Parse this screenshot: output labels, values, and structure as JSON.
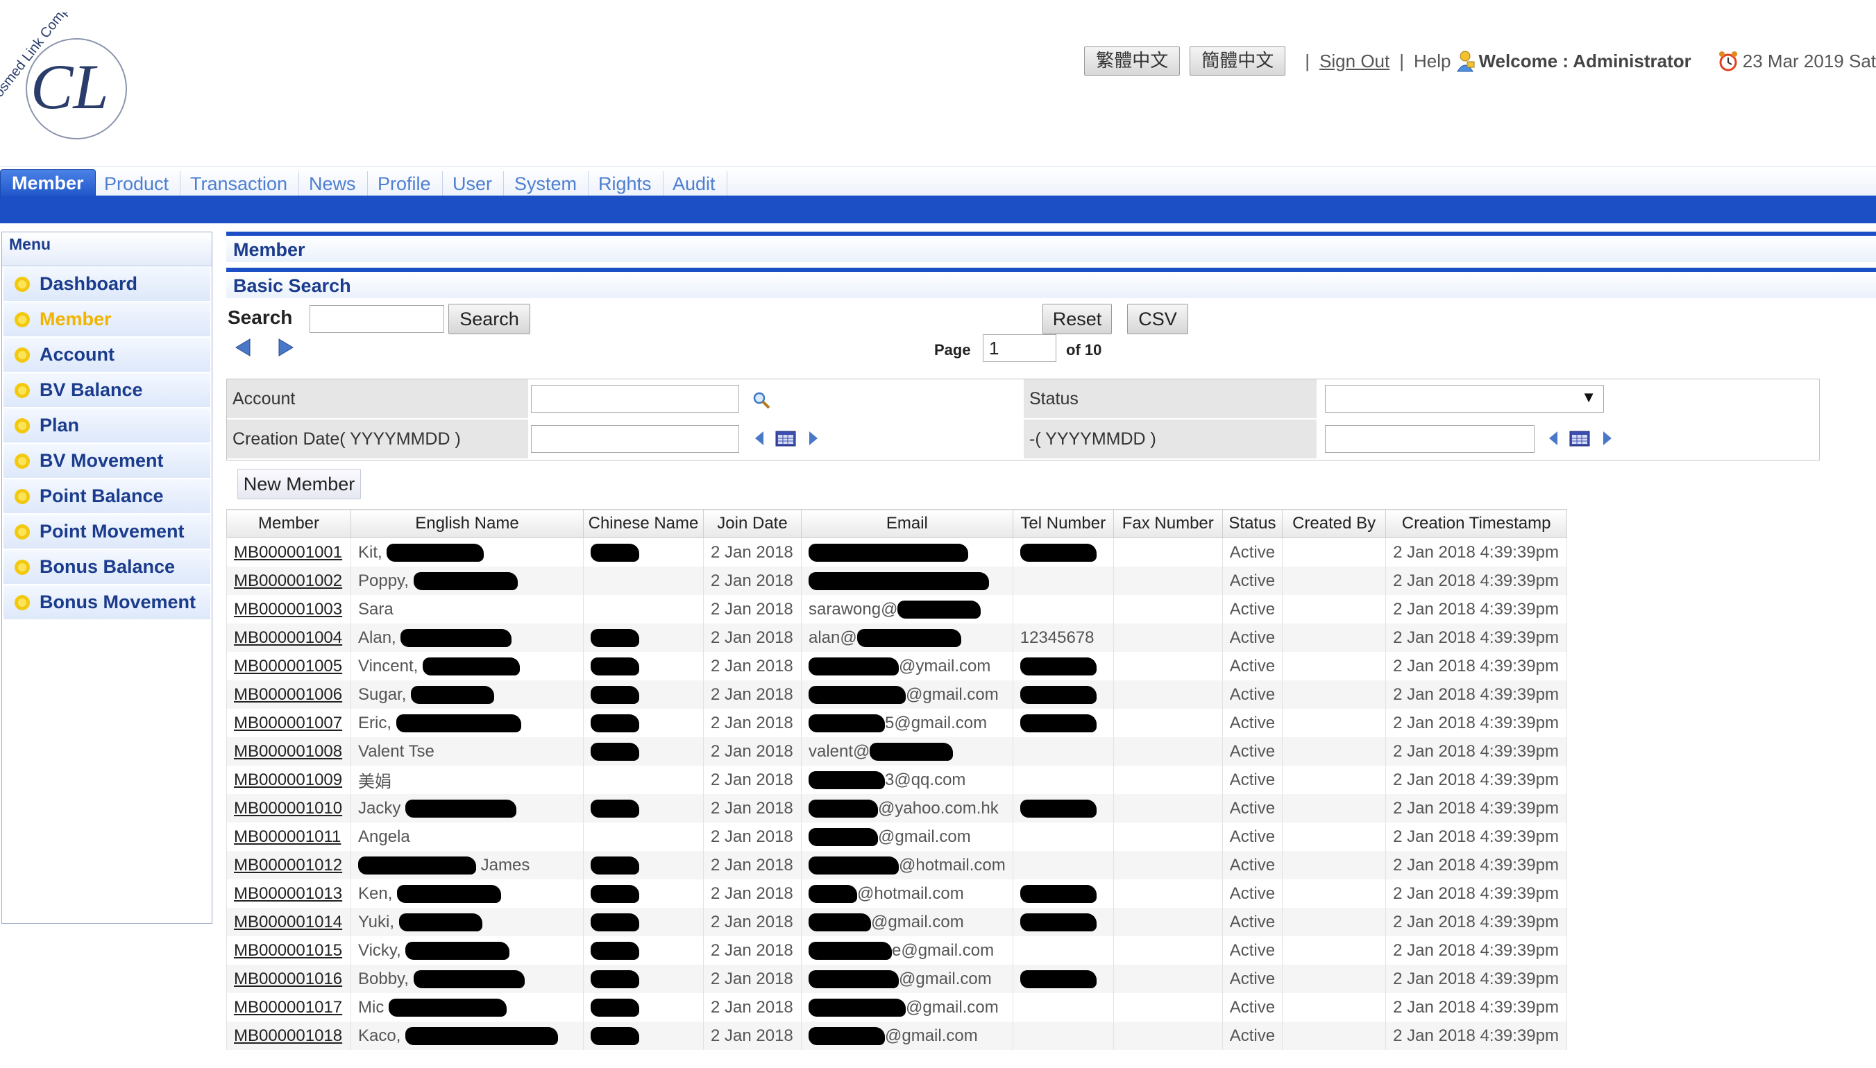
{
  "header": {
    "logo": {
      "initials": "CL",
      "ring_text": "Cosmed Link Company Ltd"
    },
    "lang_traditional": "繁體中文",
    "lang_simplified": "簡體中文",
    "separator": "|",
    "sign_out": "Sign Out",
    "help": "Help",
    "welcome": "Welcome : Administrator",
    "date": "23 Mar 2019 Sat"
  },
  "nav": {
    "tabs": [
      {
        "label": "Member",
        "active": true
      },
      {
        "label": "Product"
      },
      {
        "label": "Transaction"
      },
      {
        "label": "News"
      },
      {
        "label": "Profile"
      },
      {
        "label": "User"
      },
      {
        "label": "System"
      },
      {
        "label": "Rights"
      },
      {
        "label": "Audit"
      }
    ]
  },
  "sidebar": {
    "title": "Menu",
    "items": [
      {
        "label": "Dashboard"
      },
      {
        "label": "Member",
        "active": true
      },
      {
        "label": "Account"
      },
      {
        "label": "BV Balance"
      },
      {
        "label": "Plan"
      },
      {
        "label": "BV Movement"
      },
      {
        "label": "Point Balance"
      },
      {
        "label": "Point Movement"
      },
      {
        "label": "Bonus Balance"
      },
      {
        "label": "Bonus Movement"
      }
    ]
  },
  "main": {
    "title": "Member",
    "basic_search_title": "Basic Search",
    "search_label": "Search",
    "search_value": "",
    "search_button": "Search",
    "reset_button": "Reset",
    "csv_button": "CSV",
    "page_label": "Page",
    "page_value": "1",
    "page_of": "of 10",
    "new_member_button": "New Member",
    "filter": {
      "account_label": "Account",
      "status_label": "Status",
      "creation_date_label": "Creation Date( YYYYMMDD )",
      "creation_date_to_label": "-( YYYYMMDD )"
    }
  },
  "table": {
    "columns": [
      "Member",
      "English Name",
      "Chinese Name",
      "Join Date",
      "Email",
      "Tel Number",
      "Fax Number",
      "Status",
      "Created By",
      "Creation Timestamp"
    ],
    "rows": [
      {
        "member": "MB000001001",
        "english": "Kit,",
        "email": "",
        "tel": "",
        "status": "Active",
        "created_by": "",
        "timestamp": "2 Jan 2018 4:39:39pm",
        "join": "2 Jan 2018"
      },
      {
        "member": "MB000001002",
        "english": "Poppy,",
        "email": "",
        "tel": "",
        "status": "Active",
        "created_by": "",
        "timestamp": "2 Jan 2018 4:39:39pm",
        "join": "2 Jan 2018"
      },
      {
        "member": "MB000001003",
        "english": "Sara",
        "email": "sarawong@",
        "tel": "",
        "status": "Active",
        "created_by": "",
        "timestamp": "2 Jan 2018 4:39:39pm",
        "join": "2 Jan 2018"
      },
      {
        "member": "MB000001004",
        "english": "Alan,",
        "email": "alan@",
        "tel": "12345678",
        "status": "Active",
        "created_by": "",
        "timestamp": "2 Jan 2018 4:39:39pm",
        "join": "2 Jan 2018"
      },
      {
        "member": "MB000001005",
        "english": "Vincent,",
        "email": "@ymail.com",
        "tel": "",
        "status": "Active",
        "created_by": "",
        "timestamp": "2 Jan 2018 4:39:39pm",
        "join": "2 Jan 2018"
      },
      {
        "member": "MB000001006",
        "english": "Sugar,",
        "email": "@gmail.com",
        "tel": "",
        "status": "Active",
        "created_by": "",
        "timestamp": "2 Jan 2018 4:39:39pm",
        "join": "2 Jan 2018"
      },
      {
        "member": "MB000001007",
        "english": "Eric,",
        "email": "5@gmail.com",
        "tel": "",
        "status": "Active",
        "created_by": "",
        "timestamp": "2 Jan 2018 4:39:39pm",
        "join": "2 Jan 2018"
      },
      {
        "member": "MB000001008",
        "english": "Valent Tse",
        "email": "valent@",
        "tel": "",
        "status": "Active",
        "created_by": "",
        "timestamp": "2 Jan 2018 4:39:39pm",
        "join": "2 Jan 2018"
      },
      {
        "member": "MB000001009",
        "english": "美娟",
        "email": "3@qq.com",
        "tel": "",
        "status": "Active",
        "created_by": "",
        "timestamp": "2 Jan 2018 4:39:39pm",
        "join": "2 Jan 2018"
      },
      {
        "member": "MB000001010",
        "english": "Jacky",
        "email": "@yahoo.com.hk",
        "tel": "",
        "status": "Active",
        "created_by": "",
        "timestamp": "2 Jan 2018 4:39:39pm",
        "join": "2 Jan 2018"
      },
      {
        "member": "MB000001011",
        "english": "Angela",
        "email": "@gmail.com",
        "tel": "",
        "status": "Active",
        "created_by": "",
        "timestamp": "2 Jan 2018 4:39:39pm",
        "join": "2 Jan 2018"
      },
      {
        "member": "MB000001012",
        "english": "James",
        "email": "@hotmail.com",
        "tel": "",
        "status": "Active",
        "created_by": "",
        "timestamp": "2 Jan 2018 4:39:39pm",
        "join": "2 Jan 2018"
      },
      {
        "member": "MB000001013",
        "english": "Ken,",
        "email": "@hotmail.com",
        "tel": "",
        "status": "Active",
        "created_by": "",
        "timestamp": "2 Jan 2018 4:39:39pm",
        "join": "2 Jan 2018"
      },
      {
        "member": "MB000001014",
        "english": "Yuki,",
        "email": "@gmail.com",
        "tel": "",
        "status": "Active",
        "created_by": "",
        "timestamp": "2 Jan 2018 4:39:39pm",
        "join": "2 Jan 2018"
      },
      {
        "member": "MB000001015",
        "english": "Vicky,",
        "email": "e@gmail.com",
        "tel": "",
        "status": "Active",
        "created_by": "",
        "timestamp": "2 Jan 2018 4:39:39pm",
        "join": "2 Jan 2018"
      },
      {
        "member": "MB000001016",
        "english": "Bobby,",
        "email": "@gmail.com",
        "tel": "",
        "status": "Active",
        "created_by": "",
        "timestamp": "2 Jan 2018 4:39:39pm",
        "join": "2 Jan 2018"
      },
      {
        "member": "MB000001017",
        "english": "Mic",
        "email": "@gmail.com",
        "tel": "",
        "status": "Active",
        "created_by": "",
        "timestamp": "2 Jan 2018 4:39:39pm",
        "join": "2 Jan 2018"
      },
      {
        "member": "MB000001018",
        "english": "Kaco,",
        "email": "@gmail.com",
        "tel": "",
        "status": "Active",
        "created_by": "",
        "timestamp": "2 Jan 2018 4:39:39pm",
        "join": "2 Jan 2018"
      }
    ]
  },
  "colors": {
    "nav_blue": "#1c4fc6",
    "link_blue": "#4d7fd0",
    "menu_text": "#1b3c8c",
    "active_menu": "#f0b400"
  },
  "icons": {
    "menu_bullet": "sun-icon",
    "prev": "prev-arrow-icon",
    "next": "next-arrow-icon",
    "calendar": "calendar-icon",
    "lookup": "magnifier-icon",
    "help": "help-person-icon",
    "clock": "alarm-clock-icon"
  }
}
